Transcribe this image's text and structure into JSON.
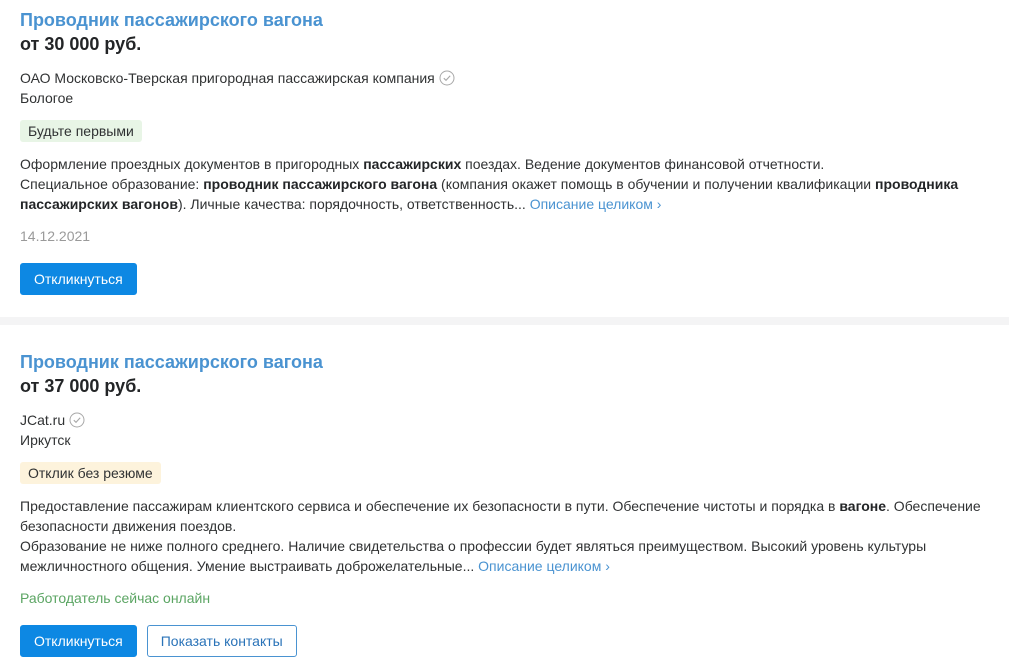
{
  "vacancies": [
    {
      "title": "Проводник пассажирского вагона",
      "salary": "от 30 000 руб.",
      "company": "ОАО Московско-Тверская пригородная пассажирская компания",
      "city": "Бологое",
      "badge": "Будьте первыми",
      "desc": {
        "l1_a": "Оформление проездных документов в пригородных ",
        "l1_b": "пассажирских",
        "l1_c": " поездах. Ведение документов финансовой отчетности.",
        "l2_a": "Специальное образование: ",
        "l2_b": "проводник пассажирского вагона",
        "l2_c": " (компания окажет помощь в обучении и получении квалификации ",
        "l2_d": "проводника пассажирских вагонов",
        "l2_e": "). Личные качества: порядочность, ответственность..."
      },
      "more_link": "Описание целиком ›",
      "date": "14.12.2021",
      "respond_label": "Откликнуться"
    },
    {
      "title": "Проводник пассажирского вагона",
      "salary": "от 37 000 руб.",
      "company": "JCat.ru",
      "city": "Иркутск",
      "badge": "Отклик без резюме",
      "desc": {
        "l1_a": "Предоставление пассажирам клиентского сервиса и обеспечение их безопасности в пути. Обеспечение чистоты и порядка в ",
        "l1_b": "вагоне",
        "l1_c": ". Обеспечение безопасности движения поездов.",
        "l2_a": "Образование не ниже полного среднего. Наличие свидетельства о профессии будет являться преимуществом. Высокий уровень культуры межличностного общения. Умение выстраивать доброжелательные..."
      },
      "more_link": "Описание целиком ›",
      "online_status": "Работодатель сейчас онлайн",
      "respond_label": "Откликнуться",
      "contacts_label": "Показать контакты"
    }
  ],
  "colors": {
    "title_link": "#4a93d1",
    "primary_button": "#0d88e3",
    "online_green": "#5ba563",
    "badge_green_bg": "#e8f5e6",
    "badge_yellow_bg": "#fdf3dc"
  }
}
